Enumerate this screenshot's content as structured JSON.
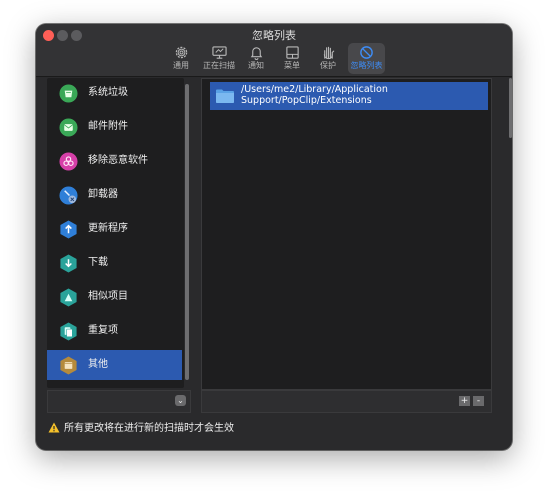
{
  "window": {
    "title": "忽略列表"
  },
  "toolbar": {
    "items": [
      {
        "label": "通用",
        "icon": "gear-icon"
      },
      {
        "label": "正在扫描",
        "icon": "display-scan-icon"
      },
      {
        "label": "通知",
        "icon": "bell-icon"
      },
      {
        "label": "菜单",
        "icon": "menu-window-icon"
      },
      {
        "label": "保护",
        "icon": "hand-shield-icon"
      },
      {
        "label": "忽略列表",
        "icon": "no-sign-icon",
        "active": true
      }
    ],
    "accent": "#3e8cf5"
  },
  "sidebar": {
    "items": [
      {
        "label": "系统垃圾",
        "icon": "trash-bin-icon",
        "color": "#3aa857"
      },
      {
        "label": "邮件附件",
        "icon": "mail-icon",
        "color": "#3aa857"
      },
      {
        "label": "移除恶意软件",
        "icon": "biohazard-icon",
        "color": "#d63fa8"
      },
      {
        "label": "卸载器",
        "icon": "uninstaller-icon",
        "color": "#2f7fd8"
      },
      {
        "label": "更新程序",
        "icon": "update-arrow-icon",
        "color": "#2f7fd8"
      },
      {
        "label": "下载",
        "icon": "download-icon",
        "color": "#2aa39a"
      },
      {
        "label": "相似项目",
        "icon": "similar-items-icon",
        "color": "#2aa39a"
      },
      {
        "label": "重复项",
        "icon": "duplicates-icon",
        "color": "#2aa39a"
      },
      {
        "label": "其他",
        "icon": "folder-icon",
        "color": "#b58a3c",
        "selected": true
      }
    ],
    "selection_color": "#2c5ab0"
  },
  "ignore_list": {
    "rows": [
      {
        "path": "/Users/me2/Library/Application Support/PopClip/Extensions",
        "icon": "folder-icon",
        "selected": true
      }
    ]
  },
  "footer": {
    "add_label": "+",
    "remove_label": "-",
    "chevron": "⌄"
  },
  "status": {
    "message": "所有更改将在进行新的扫描时才会生效",
    "icon": "warning-icon"
  }
}
